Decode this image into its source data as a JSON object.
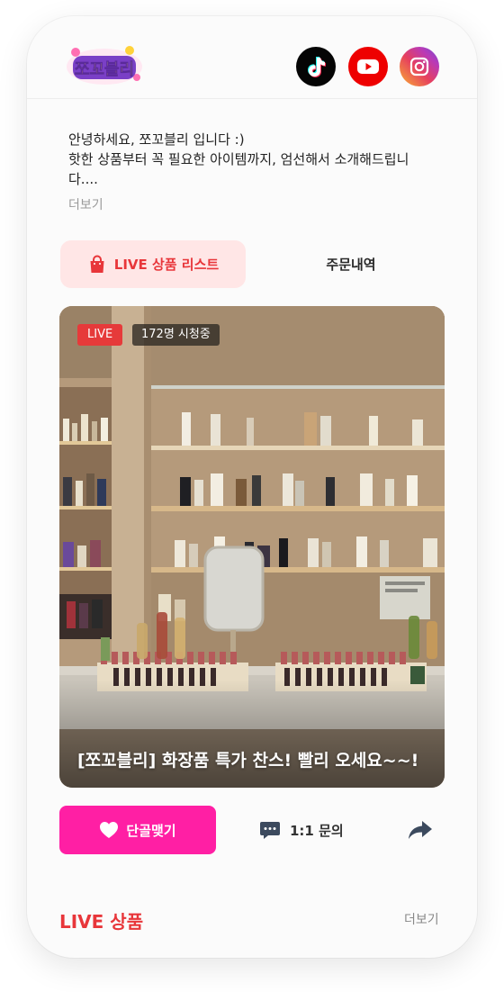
{
  "brand": {
    "logo_text": "쪼꼬블리"
  },
  "social": [
    {
      "name": "TikTok",
      "icon": "tiktok-icon",
      "color": "#050505"
    },
    {
      "name": "YouTube",
      "icon": "youtube-icon",
      "color": "#ee0000"
    },
    {
      "name": "Instagram",
      "icon": "instagram-icon",
      "color": "#e6405e"
    }
  ],
  "intro": {
    "lines": [
      "안녕하세요, 쪼꼬블리 입니다 :)",
      "핫한 상품부터 꼭 필요한 아이템까지, 엄선해서 소개해드립니",
      "다...."
    ],
    "more_label": "더보기"
  },
  "tabs": {
    "live_products": {
      "label": "LIVE 상품 리스트",
      "icon": "shopping-bag-icon",
      "active": true
    },
    "orders": {
      "label": "주문내역",
      "active": false
    }
  },
  "live": {
    "badge": "LIVE",
    "viewers": "172명 시청중",
    "title": "[쪼꼬블리] 화장품 특가 찬스! 빨리 오세요~~!"
  },
  "actions": {
    "follow_label": "단골맺기",
    "follow_icon": "heart-icon",
    "inquiry_label": "1:1 문의",
    "inquiry_icon": "chat-bubble-icon",
    "share_icon": "share-icon"
  },
  "section": {
    "title": "LIVE 상품",
    "more_label": "더보기"
  },
  "colors": {
    "accent_red": "#e8363a",
    "accent_pink": "#ff1fa4",
    "tab_active_bg": "#ffe6e6"
  }
}
